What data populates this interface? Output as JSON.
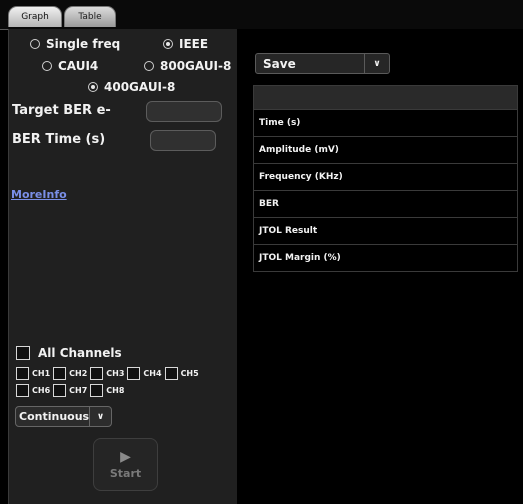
{
  "tabs": [
    {
      "label": "Graph",
      "active": true
    },
    {
      "label": "Table",
      "active": false
    }
  ],
  "modes": {
    "single_freq": {
      "label": "Single freq",
      "selected": false
    },
    "ieee": {
      "label": "IEEE",
      "selected": true
    },
    "caui4": {
      "label": "CAUI4",
      "selected": false
    },
    "gaui800": {
      "label": "800GAUI-8",
      "selected": false
    },
    "gaui400": {
      "label": "400GAUI-8",
      "selected": true
    }
  },
  "target_ber": {
    "label": "Target BER e-",
    "value": ""
  },
  "ber_time": {
    "label": "BER Time (s)",
    "value": ""
  },
  "more_info": "MoreInfo",
  "all_channels": {
    "label": "All Channels",
    "checked": false
  },
  "channels": [
    {
      "label": "CH1",
      "checked": false
    },
    {
      "label": "CH2",
      "checked": false
    },
    {
      "label": "CH3",
      "checked": false
    },
    {
      "label": "CH4",
      "checked": false
    },
    {
      "label": "CH5",
      "checked": false
    },
    {
      "label": "CH6",
      "checked": false
    },
    {
      "label": "CH7",
      "checked": false
    },
    {
      "label": "CH8",
      "checked": false
    }
  ],
  "run_mode": {
    "value": "Continuous",
    "arrow": "chevron-down-icon"
  },
  "start_button": {
    "label": "Start",
    "icon": "play-icon",
    "enabled": false
  },
  "save_select": {
    "value": "Save",
    "arrow": "chevron-down-icon"
  },
  "table": {
    "rows": [
      "Time (s)",
      "Amplitude (mV)",
      "Frequency (KHz)",
      "BER",
      "JTOL Result",
      "JTOL Margin (%)"
    ]
  },
  "colors": {
    "background": "#000000",
    "panel": "#202020",
    "link": "#7a8fe8"
  }
}
